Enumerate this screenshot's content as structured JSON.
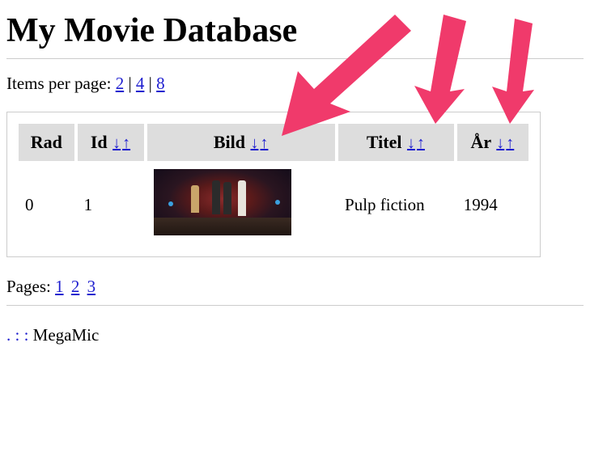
{
  "header": {
    "title": "My Movie Database"
  },
  "items_per_page": {
    "label": "Items per page:",
    "options": [
      "2",
      "4",
      "8"
    ],
    "separator": " | "
  },
  "table": {
    "columns": [
      {
        "label": "Rad",
        "sortable": false
      },
      {
        "label": "Id",
        "sortable": true
      },
      {
        "label": "Bild",
        "sortable": true
      },
      {
        "label": "Titel",
        "sortable": true
      },
      {
        "label": "År",
        "sortable": true
      }
    ],
    "sort_desc_glyph": "↓",
    "sort_asc_glyph": "↑",
    "rows": [
      {
        "rad": "0",
        "id": "1",
        "titel": "Pulp fiction",
        "ar": "1994"
      }
    ]
  },
  "pagination": {
    "label": "Pages:",
    "pages": [
      "1",
      "2",
      "3"
    ]
  },
  "footer": {
    "prefix": ". :  : ",
    "credit": "MegaMic"
  }
}
